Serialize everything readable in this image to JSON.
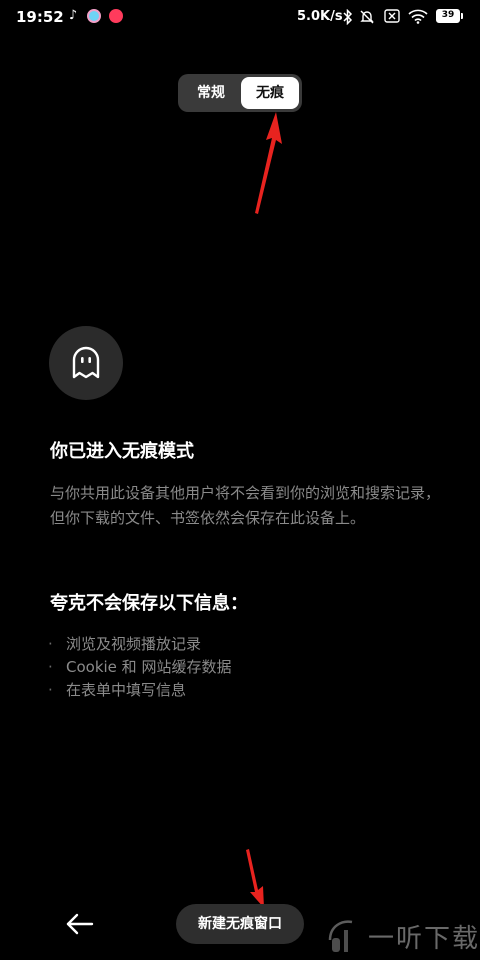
{
  "status_bar": {
    "time": "19:52",
    "speed": "5.0K/s",
    "battery": "39",
    "icons": [
      "tiktok-icon",
      "app-icon",
      "music-icon",
      "bluetooth-icon",
      "mute-icon",
      "no-sim-icon",
      "wifi-icon",
      "battery-icon"
    ]
  },
  "mode_toggle": {
    "normal_label": "常规",
    "incognito_label": "无痕",
    "selected": "incognito"
  },
  "content": {
    "title": "你已进入无痕模式",
    "description": "与你共用此设备其他用户将不会看到你的浏览和搜索记录，但你下载的文件、书签依然会保存在此设备上。",
    "save_title": "夸克不会保存以下信息：",
    "items": [
      "浏览及视频播放记录",
      "Cookie 和 网站缓存数据",
      "在表单中填写信息"
    ],
    "bullet": "·"
  },
  "bottom_bar": {
    "new_window_label": "新建无痕窗口",
    "watermark": "一听下载"
  },
  "colors": {
    "background": "#000000",
    "accent_arrow": "#e8231f",
    "muted_text": "#8a8a8a"
  }
}
